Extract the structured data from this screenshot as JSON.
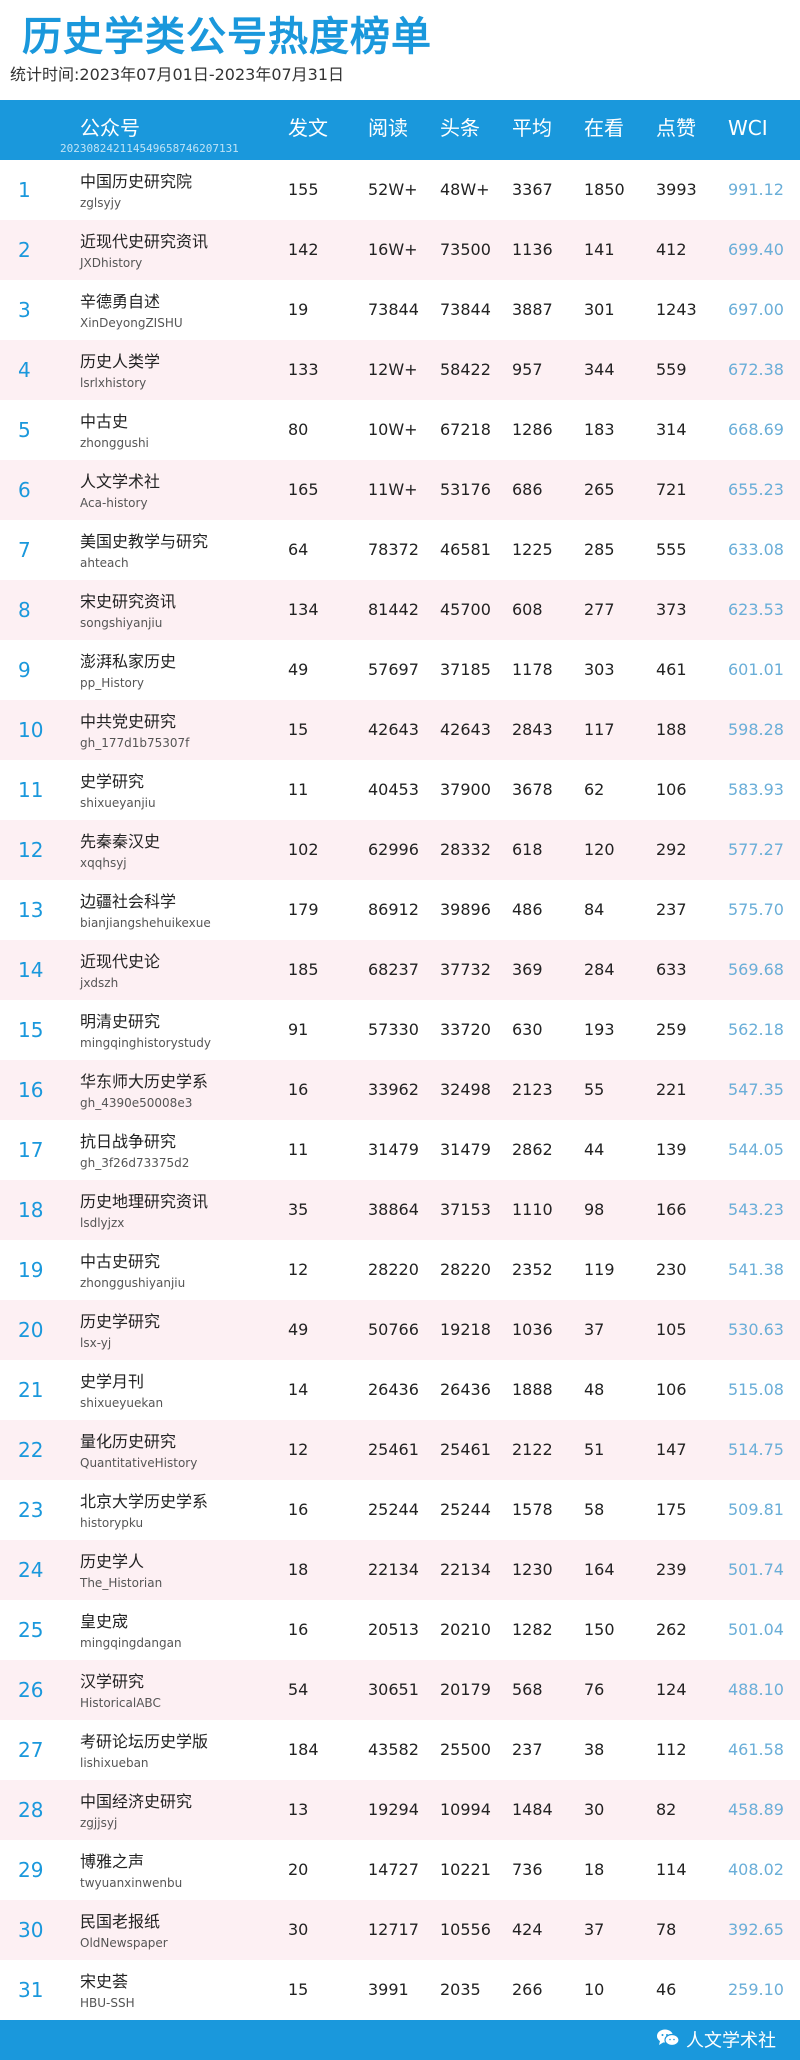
{
  "title": "历史学类公号热度榜单",
  "subtitle": "统计时间:2023年07月01日-2023年07月31日",
  "header": {
    "account": "公众号",
    "account_code": "20230824211454965874620713​1",
    "posts": "发文",
    "reads": "阅读",
    "headline": "头条",
    "avg": "平均",
    "looking": "在看",
    "likes": "点赞",
    "wci": "WCI"
  },
  "rows": [
    {
      "rank": "1",
      "name": "中国历史研究院",
      "code": "zglsyjy",
      "posts": "155",
      "reads": "52W+",
      "head": "48W+",
      "avg": "3367",
      "look": "1850",
      "likes": "3993",
      "wci": "991.12"
    },
    {
      "rank": "2",
      "name": "近现代史研究资讯",
      "code": "JXDhistory",
      "posts": "142",
      "reads": "16W+",
      "head": "73500",
      "avg": "1136",
      "look": "141",
      "likes": "412",
      "wci": "699.40"
    },
    {
      "rank": "3",
      "name": "辛德勇自述",
      "code": "XinDeyongZISHU",
      "posts": "19",
      "reads": "73844",
      "head": "73844",
      "avg": "3887",
      "look": "301",
      "likes": "1243",
      "wci": "697.00"
    },
    {
      "rank": "4",
      "name": "历史人类学",
      "code": "lsrlxhistory",
      "posts": "133",
      "reads": "12W+",
      "head": "58422",
      "avg": "957",
      "look": "344",
      "likes": "559",
      "wci": "672.38"
    },
    {
      "rank": "5",
      "name": "中古史",
      "code": "zhonggushi",
      "posts": "80",
      "reads": "10W+",
      "head": "67218",
      "avg": "1286",
      "look": "183",
      "likes": "314",
      "wci": "668.69"
    },
    {
      "rank": "6",
      "name": "人文学术社",
      "code": "Aca-history",
      "posts": "165",
      "reads": "11W+",
      "head": "53176",
      "avg": "686",
      "look": "265",
      "likes": "721",
      "wci": "655.23"
    },
    {
      "rank": "7",
      "name": "美国史教学与研究",
      "code": "ahteach",
      "posts": "64",
      "reads": "78372",
      "head": "46581",
      "avg": "1225",
      "look": "285",
      "likes": "555",
      "wci": "633.08"
    },
    {
      "rank": "8",
      "name": "宋史研究资讯",
      "code": "songshiyanjiu",
      "posts": "134",
      "reads": "81442",
      "head": "45700",
      "avg": "608",
      "look": "277",
      "likes": "373",
      "wci": "623.53"
    },
    {
      "rank": "9",
      "name": "澎湃私家历史",
      "code": "pp_History",
      "posts": "49",
      "reads": "57697",
      "head": "37185",
      "avg": "1178",
      "look": "303",
      "likes": "461",
      "wci": "601.01"
    },
    {
      "rank": "10",
      "name": "中共党史研究",
      "code": "gh_177d1b75307f",
      "posts": "15",
      "reads": "42643",
      "head": "42643",
      "avg": "2843",
      "look": "117",
      "likes": "188",
      "wci": "598.28"
    },
    {
      "rank": "11",
      "name": "史学研究",
      "code": "shixueyanjiu",
      "posts": "11",
      "reads": "40453",
      "head": "37900",
      "avg": "3678",
      "look": "62",
      "likes": "106",
      "wci": "583.93"
    },
    {
      "rank": "12",
      "name": "先秦秦汉史",
      "code": "xqqhsyj",
      "posts": "102",
      "reads": "62996",
      "head": "28332",
      "avg": "618",
      "look": "120",
      "likes": "292",
      "wci": "577.27"
    },
    {
      "rank": "13",
      "name": "边疆社会科学",
      "code": "bianjiangshehuikexue",
      "posts": "179",
      "reads": "86912",
      "head": "39896",
      "avg": "486",
      "look": "84",
      "likes": "237",
      "wci": "575.70"
    },
    {
      "rank": "14",
      "name": "近现代史论",
      "code": "jxdszh",
      "posts": "185",
      "reads": "68237",
      "head": "37732",
      "avg": "369",
      "look": "284",
      "likes": "633",
      "wci": "569.68"
    },
    {
      "rank": "15",
      "name": "明清史研究",
      "code": "mingqinghistorystudy",
      "posts": "91",
      "reads": "57330",
      "head": "33720",
      "avg": "630",
      "look": "193",
      "likes": "259",
      "wci": "562.18"
    },
    {
      "rank": "16",
      "name": "华东师大历史学系",
      "code": "gh_4390e50008e3",
      "posts": "16",
      "reads": "33962",
      "head": "32498",
      "avg": "2123",
      "look": "55",
      "likes": "221",
      "wci": "547.35"
    },
    {
      "rank": "17",
      "name": "抗日战争研究",
      "code": "gh_3f26d73375d2",
      "posts": "11",
      "reads": "31479",
      "head": "31479",
      "avg": "2862",
      "look": "44",
      "likes": "139",
      "wci": "544.05"
    },
    {
      "rank": "18",
      "name": "历史地理研究资讯",
      "code": "lsdlyjzx",
      "posts": "35",
      "reads": "38864",
      "head": "37153",
      "avg": "1110",
      "look": "98",
      "likes": "166",
      "wci": "543.23"
    },
    {
      "rank": "19",
      "name": "中古史研究",
      "code": "zhonggushiyanjiu",
      "posts": "12",
      "reads": "28220",
      "head": "28220",
      "avg": "2352",
      "look": "119",
      "likes": "230",
      "wci": "541.38"
    },
    {
      "rank": "20",
      "name": "历史学研究",
      "code": "lsx-yj",
      "posts": "49",
      "reads": "50766",
      "head": "19218",
      "avg": "1036",
      "look": "37",
      "likes": "105",
      "wci": "530.63"
    },
    {
      "rank": "21",
      "name": "史学月刊",
      "code": "shixueyuekan",
      "posts": "14",
      "reads": "26436",
      "head": "26436",
      "avg": "1888",
      "look": "48",
      "likes": "106",
      "wci": "515.08"
    },
    {
      "rank": "22",
      "name": "量化历史研究",
      "code": "QuantitativeHistory",
      "posts": "12",
      "reads": "25461",
      "head": "25461",
      "avg": "2122",
      "look": "51",
      "likes": "147",
      "wci": "514.75"
    },
    {
      "rank": "23",
      "name": "北京大学历史学系",
      "code": "historypku",
      "posts": "16",
      "reads": "25244",
      "head": "25244",
      "avg": "1578",
      "look": "58",
      "likes": "175",
      "wci": "509.81"
    },
    {
      "rank": "24",
      "name": "历史学人",
      "code": "The_Historian",
      "posts": "18",
      "reads": "22134",
      "head": "22134",
      "avg": "1230",
      "look": "164",
      "likes": "239",
      "wci": "501.74"
    },
    {
      "rank": "25",
      "name": "皇史宬",
      "code": "mingqingdangan",
      "posts": "16",
      "reads": "20513",
      "head": "20210",
      "avg": "1282",
      "look": "150",
      "likes": "262",
      "wci": "501.04"
    },
    {
      "rank": "26",
      "name": "汉学研究",
      "code": "HistoricalABC",
      "posts": "54",
      "reads": "30651",
      "head": "20179",
      "avg": "568",
      "look": "76",
      "likes": "124",
      "wci": "488.10"
    },
    {
      "rank": "27",
      "name": "考研论坛历史学版",
      "code": "lishixueban",
      "posts": "184",
      "reads": "43582",
      "head": "25500",
      "avg": "237",
      "look": "38",
      "likes": "112",
      "wci": "461.58"
    },
    {
      "rank": "28",
      "name": "中国经济史研究",
      "code": "zgjjsyj",
      "posts": "13",
      "reads": "19294",
      "head": "10994",
      "avg": "1484",
      "look": "30",
      "likes": "82",
      "wci": "458.89"
    },
    {
      "rank": "29",
      "name": "博雅之声",
      "code": "twyuanxinwenbu",
      "posts": "20",
      "reads": "14727",
      "head": "10221",
      "avg": "736",
      "look": "18",
      "likes": "114",
      "wci": "408.02"
    },
    {
      "rank": "30",
      "name": "民国老报纸",
      "code": "OldNewspaper",
      "posts": "30",
      "reads": "12717",
      "head": "10556",
      "avg": "424",
      "look": "37",
      "likes": "78",
      "wci": "392.65"
    },
    {
      "rank": "31",
      "name": "宋史荟",
      "code": "HBU-SSH",
      "posts": "15",
      "reads": "3991",
      "head": "2035",
      "avg": "266",
      "look": "10",
      "likes": "46",
      "wci": "259.10"
    }
  ],
  "footer": {
    "brand": "人文学术社",
    "brand_icon": "wechat-icon"
  },
  "colors": {
    "accent": "#1a98dc",
    "alt_row": "#fdf0f3",
    "wci": "#6aaed8"
  }
}
